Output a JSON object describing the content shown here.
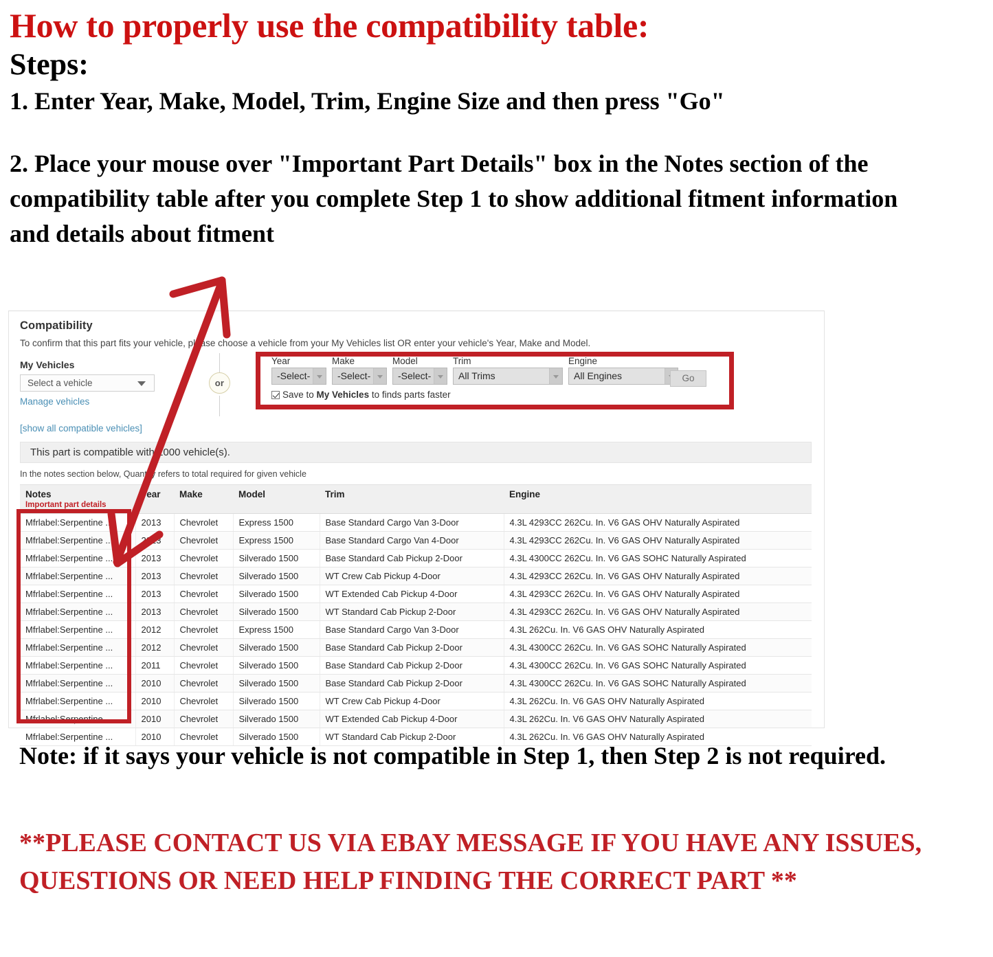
{
  "instructions": {
    "headline": "How to properly use the compatibility table:",
    "steps_label": "Steps:",
    "step1": "1. Enter Year, Make, Model, Trim, Engine Size and then press \"Go\"",
    "step2": "2. Place your mouse over \"Important Part Details\" box in the Notes section of the compatibility table after you complete Step 1 to show additional fitment information and details about fitment"
  },
  "compat": {
    "title": "Compatibility",
    "subtitle": "To confirm that this part fits your vehicle, please choose a vehicle from your My Vehicles list OR enter your vehicle's Year, Make and Model.",
    "my_vehicles_label": "My Vehicles",
    "my_vehicles_value": "Select a vehicle",
    "manage_vehicles_link": "Manage vehicles",
    "show_all_link": "[show all compatible vehicles]",
    "or_text": "or",
    "banner": "This part is compatible with 1000 vehicle(s).",
    "notes_hint": "In the notes section below, Quantity refers to total required for given vehicle",
    "form": {
      "year_label": "Year",
      "year_value": "-Select-",
      "make_label": "Make",
      "make_value": "-Select-",
      "model_label": "Model",
      "model_value": "-Select-",
      "trim_label": "Trim",
      "trim_value": "All Trims",
      "engine_label": "Engine",
      "engine_value": "All Engines",
      "go_label": "Go",
      "save_text_pre": "Save to ",
      "save_text_bold": "My Vehicles",
      "save_text_post": " to finds parts faster"
    },
    "table": {
      "headers": {
        "notes": "Notes",
        "notes_sub": "Important part details",
        "year": "Year",
        "make": "Make",
        "model": "Model",
        "trim": "Trim",
        "engine": "Engine"
      },
      "rows": [
        {
          "notes": "Mfrlabel:Serpentine ...",
          "year": "2013",
          "make": "Chevrolet",
          "model": "Express 1500",
          "trim": "Base Standard Cargo Van 3-Door",
          "engine": "4.3L 4293CC 262Cu. In. V6 GAS OHV Naturally Aspirated"
        },
        {
          "notes": "Mfrlabel:Serpentine ...",
          "year": "2013",
          "make": "Chevrolet",
          "model": "Express 1500",
          "trim": "Base Standard Cargo Van 4-Door",
          "engine": "4.3L 4293CC 262Cu. In. V6 GAS OHV Naturally Aspirated"
        },
        {
          "notes": "Mfrlabel:Serpentine ...",
          "year": "2013",
          "make": "Chevrolet",
          "model": "Silverado 1500",
          "trim": "Base Standard Cab Pickup 2-Door",
          "engine": "4.3L 4300CC 262Cu. In. V6 GAS SOHC Naturally Aspirated"
        },
        {
          "notes": "Mfrlabel:Serpentine ...",
          "year": "2013",
          "make": "Chevrolet",
          "model": "Silverado 1500",
          "trim": "WT Crew Cab Pickup 4-Door",
          "engine": "4.3L 4293CC 262Cu. In. V6 GAS OHV Naturally Aspirated"
        },
        {
          "notes": "Mfrlabel:Serpentine ...",
          "year": "2013",
          "make": "Chevrolet",
          "model": "Silverado 1500",
          "trim": "WT Extended Cab Pickup 4-Door",
          "engine": "4.3L 4293CC 262Cu. In. V6 GAS OHV Naturally Aspirated"
        },
        {
          "notes": "Mfrlabel:Serpentine ...",
          "year": "2013",
          "make": "Chevrolet",
          "model": "Silverado 1500",
          "trim": "WT Standard Cab Pickup 2-Door",
          "engine": "4.3L 4293CC 262Cu. In. V6 GAS OHV Naturally Aspirated"
        },
        {
          "notes": "Mfrlabel:Serpentine ...",
          "year": "2012",
          "make": "Chevrolet",
          "model": "Express 1500",
          "trim": "Base Standard Cargo Van 3-Door",
          "engine": "4.3L 262Cu. In. V6 GAS OHV Naturally Aspirated"
        },
        {
          "notes": "Mfrlabel:Serpentine ...",
          "year": "2012",
          "make": "Chevrolet",
          "model": "Silverado 1500",
          "trim": "Base Standard Cab Pickup 2-Door",
          "engine": "4.3L 4300CC 262Cu. In. V6 GAS SOHC Naturally Aspirated"
        },
        {
          "notes": "Mfrlabel:Serpentine ...",
          "year": "2011",
          "make": "Chevrolet",
          "model": "Silverado 1500",
          "trim": "Base Standard Cab Pickup 2-Door",
          "engine": "4.3L 4300CC 262Cu. In. V6 GAS SOHC Naturally Aspirated"
        },
        {
          "notes": "Mfrlabel:Serpentine ...",
          "year": "2010",
          "make": "Chevrolet",
          "model": "Silverado 1500",
          "trim": "Base Standard Cab Pickup 2-Door",
          "engine": "4.3L 4300CC 262Cu. In. V6 GAS SOHC Naturally Aspirated"
        },
        {
          "notes": "Mfrlabel:Serpentine ...",
          "year": "2010",
          "make": "Chevrolet",
          "model": "Silverado 1500",
          "trim": "WT Crew Cab Pickup 4-Door",
          "engine": "4.3L 262Cu. In. V6 GAS OHV Naturally Aspirated"
        },
        {
          "notes": "Mfrlabel:Serpentine ...",
          "year": "2010",
          "make": "Chevrolet",
          "model": "Silverado 1500",
          "trim": "WT Extended Cab Pickup 4-Door",
          "engine": "4.3L 262Cu. In. V6 GAS OHV Naturally Aspirated"
        },
        {
          "notes": "Mfrlabel:Serpentine ...",
          "year": "2010",
          "make": "Chevrolet",
          "model": "Silverado 1500",
          "trim": "WT Standard Cab Pickup 2-Door",
          "engine": "4.3L 262Cu. In. V6 GAS OHV Naturally Aspirated"
        }
      ]
    }
  },
  "footer": {
    "note": "Note: if it says your vehicle is not compatible in Step 1, then Step 2 is not required.",
    "contact": "**PLEASE CONTACT US VIA EBAY MESSAGE IF YOU HAVE ANY ISSUES, QUESTIONS OR NEED HELP FINDING THE CORRECT PART **"
  },
  "colors": {
    "headline_red": "#cc1111",
    "annotation_red": "#c02026",
    "link_blue": "#4a8fb5"
  }
}
